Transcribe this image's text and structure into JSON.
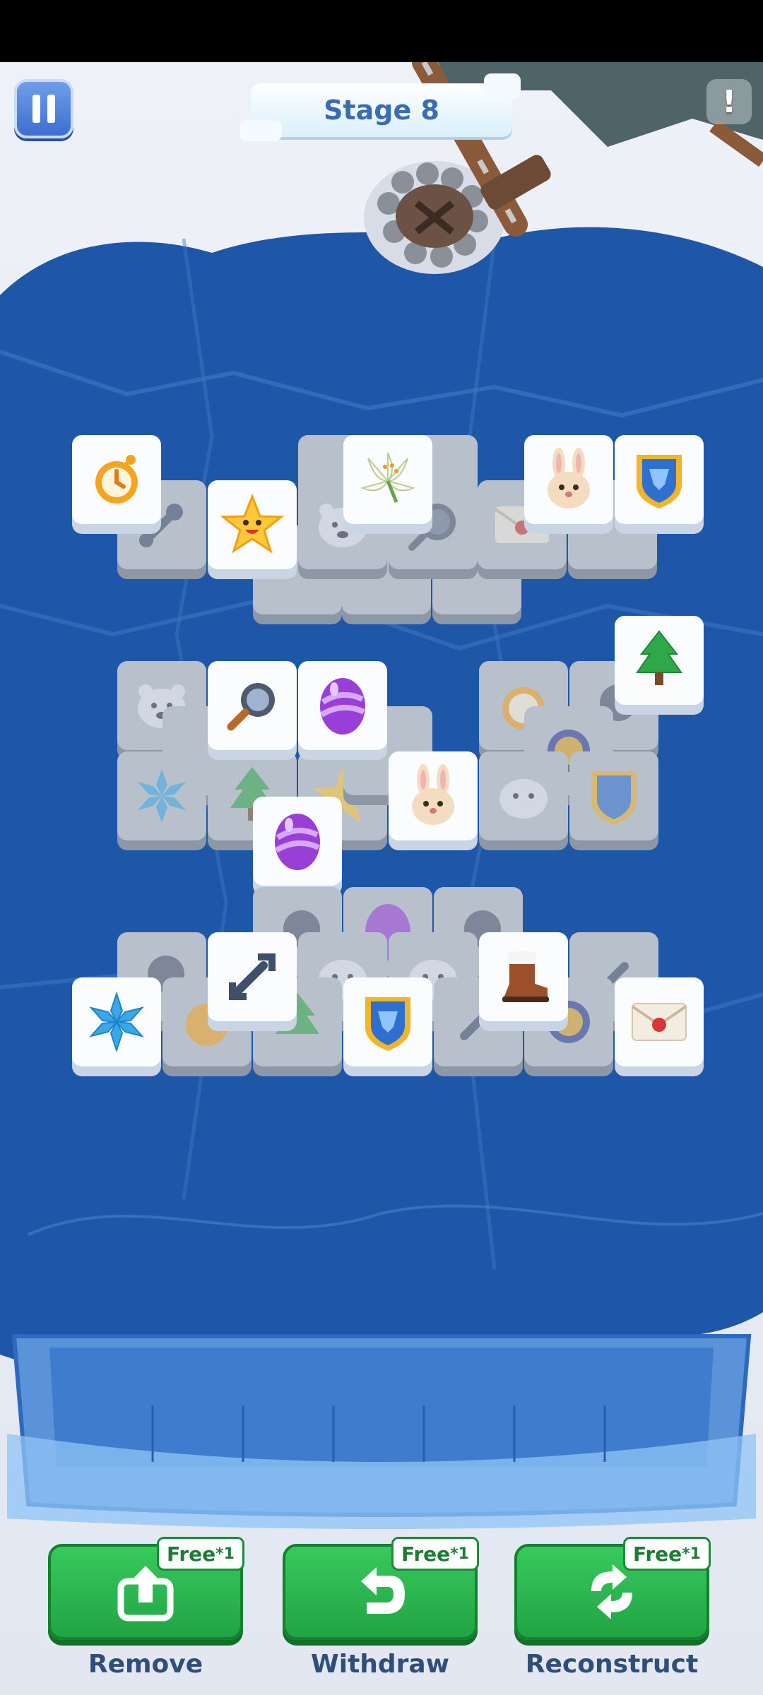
{
  "header": {
    "stage_title": "Stage 8",
    "pause_icon": "pause-icon",
    "info_icon": "exclamation-icon",
    "info_text": "!"
  },
  "board": {
    "tile_kinds": [
      "alarm-clock",
      "star",
      "lily",
      "bunny",
      "shield",
      "wrench",
      "polar-bear",
      "magnifier",
      "egg",
      "pine-tree",
      "snowflake",
      "boot",
      "letter",
      "frying-pan",
      "medal",
      "log"
    ]
  },
  "tray": {
    "slots": 8
  },
  "boosters": [
    {
      "label": "Remove",
      "badge": "Free ",
      "badge_count": "*1",
      "icon": "upload-icon"
    },
    {
      "label": "Withdraw",
      "badge": "Free ",
      "badge_count": "*1",
      "icon": "undo-icon"
    },
    {
      "label": "Reconstruct",
      "badge": "Free ",
      "badge_count": "*1",
      "icon": "shuffle-icon"
    }
  ],
  "colors": {
    "ice": "#1f57a8",
    "button_green": "#2ab84f",
    "stage_text": "#3b6bb3",
    "label_text": "#2f4f7a"
  }
}
